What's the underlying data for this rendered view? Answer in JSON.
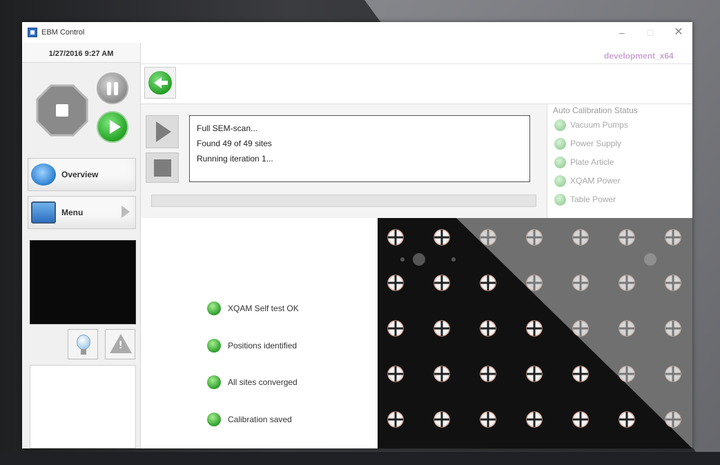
{
  "window": {
    "title": "EBM Control",
    "controls": {
      "minimize": "–",
      "maximize": "□",
      "close": "✕"
    },
    "environment": "development_x64"
  },
  "sidebar": {
    "datetime": "1/27/2016 9:27 AM",
    "nav": [
      {
        "label": "Overview",
        "icon": "globe-search-icon"
      },
      {
        "label": "Menu",
        "icon": "tablet-menu-icon"
      }
    ]
  },
  "scan_log": [
    "Full SEM-scan...",
    "Found 49 of 49 sites",
    "Running iteration 1..."
  ],
  "calibration": {
    "title": "Auto Calibration Status",
    "items": [
      "Vacuum Pumps",
      "Power Supply",
      "Plate Article",
      "XQAM Power",
      "Table Power"
    ]
  },
  "checks": [
    "XQAM Self test OK",
    "Positions identified",
    "All sites converged",
    "Calibration saved"
  ],
  "target_grid": {
    "rows": 5,
    "cols": 7
  },
  "colors": {
    "accent_green": "#2e9e2e",
    "environment_label": "#c9a3d1",
    "status_inactive": "#9fd39f"
  }
}
